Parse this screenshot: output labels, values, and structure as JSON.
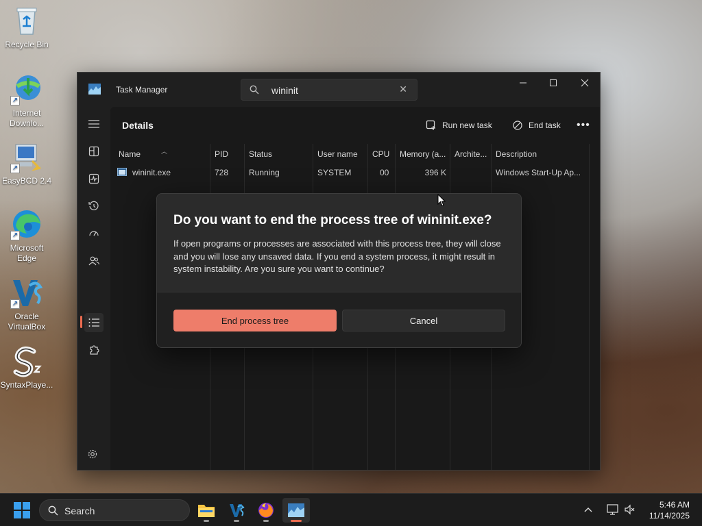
{
  "desktop": {
    "icons": [
      {
        "label": "Recycle Bin"
      },
      {
        "label": "Internet Downlo..."
      },
      {
        "label": "EasyBCD 2.4"
      },
      {
        "label": "Microsoft Edge"
      },
      {
        "label": "Oracle VirtualBox"
      },
      {
        "label": "SyntaxPlaye..."
      }
    ]
  },
  "window": {
    "title": "Task Manager",
    "search_value": "wininit",
    "heading": "Details",
    "toolbar": {
      "run_new_task": "Run new task",
      "end_task": "End task",
      "more": "•••"
    },
    "columns": [
      "Name",
      "PID",
      "Status",
      "User name",
      "CPU",
      "Memory (a...",
      "Archite...",
      "Description"
    ],
    "rows": [
      {
        "name": "wininit.exe",
        "pid": "728",
        "status": "Running",
        "user": "SYSTEM",
        "cpu": "00",
        "memory": "396 K",
        "arch": "",
        "description": "Windows Start-Up Ap..."
      }
    ]
  },
  "dialog": {
    "title": "Do you want to end the process tree of wininit.exe?",
    "message": "If open programs or processes are associated with this process tree, they will close and you will lose any unsaved data. If you end a system process, it might result in system instability. Are you sure you want to continue?",
    "primary_label": "End process tree",
    "secondary_label": "Cancel"
  },
  "taskbar": {
    "search_label": "Search",
    "time": "5:46 AM",
    "date": "11/14/2025"
  },
  "colors": {
    "accent": "#ee7d6a",
    "window_bg": "#1f1f1f",
    "dialog_bg": "#2b2b2b"
  }
}
